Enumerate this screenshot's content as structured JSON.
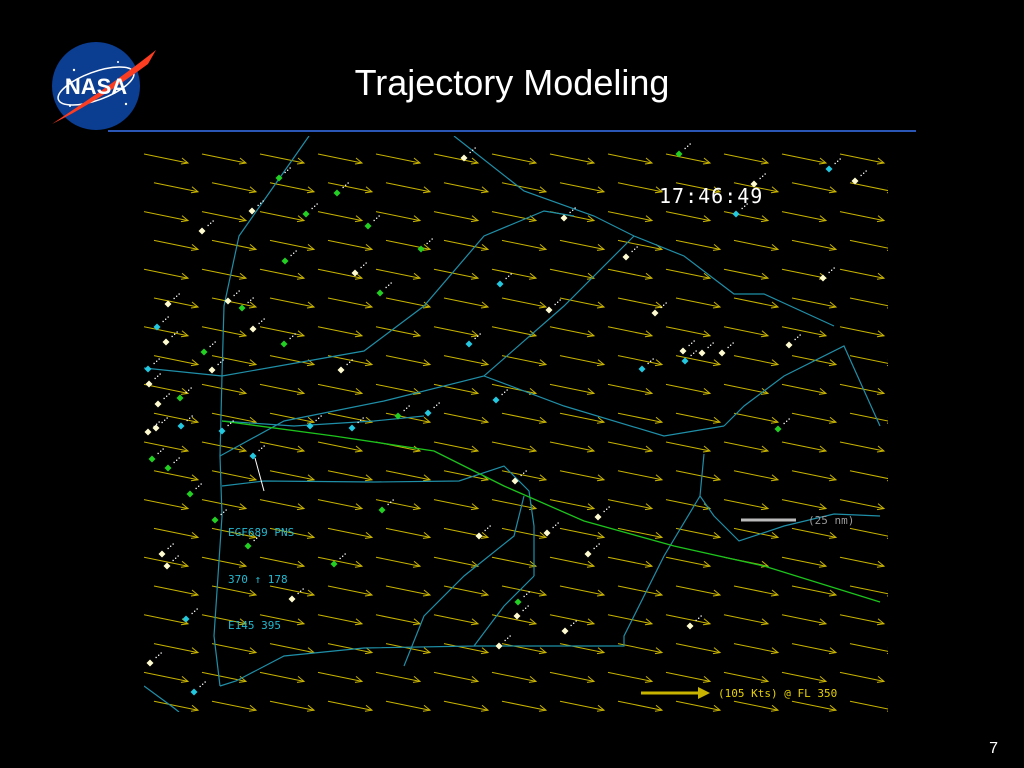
{
  "slide": {
    "title": "Trajectory Modeling",
    "page_number": "7",
    "logo_text": "NASA"
  },
  "display": {
    "clock": "17:46:49",
    "datablock": {
      "line1": "EGF689 PNS",
      "line2": "370 ↑ 178",
      "line3": "E145 395"
    },
    "scale_label": "(25 nm)",
    "wind_label": "(105 Kts) @ FL 350"
  },
  "colors": {
    "background": "#000000",
    "wind_vectors": "#c8b400",
    "sector_lines": "#1f8fa8",
    "route_line": "#1cc41c",
    "aircraft_white": "#fffbd0",
    "aircraft_green": "#22d022",
    "aircraft_cyan": "#22c8e0",
    "title_rule": "#2a57b5"
  }
}
